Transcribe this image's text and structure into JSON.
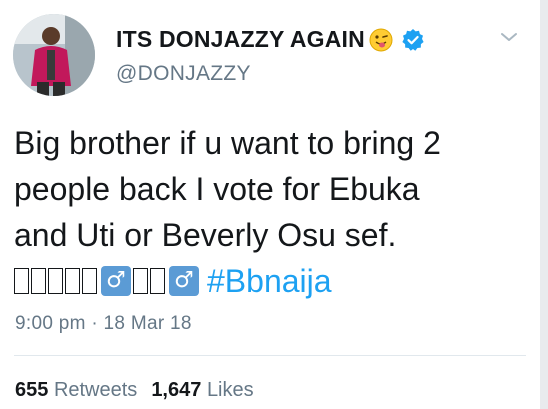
{
  "user": {
    "display_name": "ITS DONJAZZY AGAIN",
    "handle": "@DONJAZZY",
    "verified": true
  },
  "icons": {
    "emoji": "winking-tongue-emoji-icon",
    "verified": "verified-badge-icon",
    "menu": "chevron-down-icon",
    "male_sign": "male-sign-emoji-icon"
  },
  "tweet": {
    "lines": [
      "Big brother if u want to bring 2",
      "people back I vote for Ebuka",
      "and Uti or Beverly Osu sef."
    ],
    "male_sign_glyph": "♂",
    "hashtag": "#Bbnaija"
  },
  "timestamp": "9:00 pm · 18 Mar 18",
  "stats": {
    "retweets_count": "655",
    "retweets_label": "Retweets",
    "likes_count": "1,647",
    "likes_label": "Likes"
  },
  "colors": {
    "text": "#14171a",
    "secondary": "#657786",
    "link": "#1da1f2",
    "verified": "#1da1f2",
    "divider": "#e1e8ed"
  }
}
